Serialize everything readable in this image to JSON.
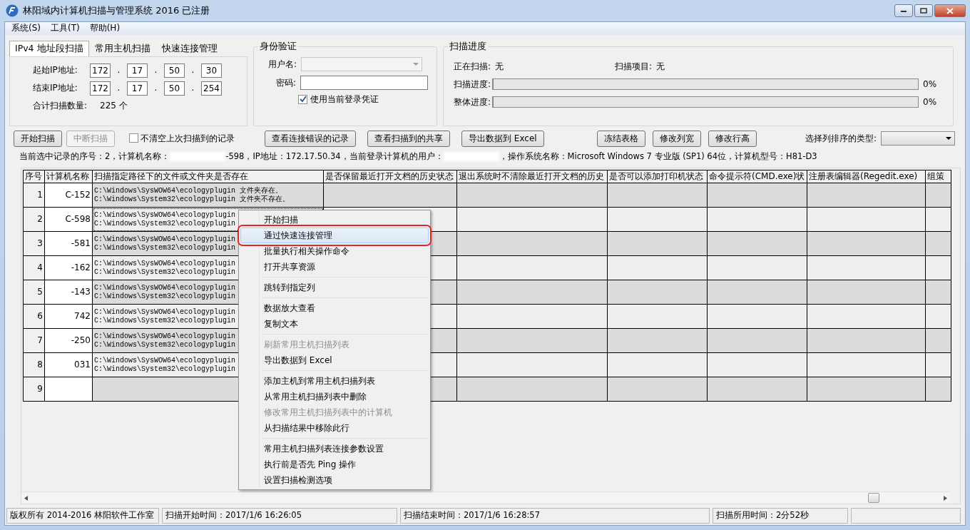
{
  "window": {
    "title": "林阳域内计算机扫描与管理系统 2016 已注册"
  },
  "menu": [
    "系统(S)",
    "工具(T)",
    "帮助(H)"
  ],
  "tabs": [
    {
      "label": "IPv4 地址段扫描",
      "selected": true
    },
    {
      "label": "常用主机扫描",
      "selected": false
    },
    {
      "label": "快速连接管理",
      "selected": false
    }
  ],
  "ip_range": {
    "rows": [
      {
        "label": "起始IP地址:",
        "parts": [
          {
            "kind": "field",
            "value": "172"
          },
          {
            "kind": "dot",
            "text": "."
          },
          {
            "kind": "field",
            "value": "17"
          },
          {
            "kind": "dot",
            "text": "."
          },
          {
            "kind": "field",
            "value": "50"
          },
          {
            "kind": "dot",
            "text": "."
          },
          {
            "kind": "field",
            "value": "30"
          }
        ]
      },
      {
        "label": "结束IP地址:",
        "parts": [
          {
            "kind": "field",
            "value": "172"
          },
          {
            "kind": "dot",
            "text": "."
          },
          {
            "kind": "field",
            "value": "17"
          },
          {
            "kind": "dot",
            "text": "."
          },
          {
            "kind": "field",
            "value": "50"
          },
          {
            "kind": "dot",
            "text": "."
          },
          {
            "kind": "field",
            "value": "254"
          }
        ]
      }
    ],
    "count_label": "合计扫描数量:",
    "count_value": "225 个"
  },
  "auth": {
    "title": "身份验证",
    "username_label": "用户名:",
    "username_disabled": true,
    "password_label": "密码:",
    "use_current": {
      "label": "使用当前登录凭证",
      "checked": true
    }
  },
  "progress": {
    "title": "扫描进度",
    "scanning_label": "正在扫描:",
    "scanning_value": "无",
    "item_label": "扫描项目:",
    "item_value": "无",
    "bars": [
      {
        "label": "扫描进度:",
        "level": 0,
        "reading": "0%"
      },
      {
        "label": "整体进度:",
        "level": 0,
        "reading": "0%"
      }
    ]
  },
  "toolbar": {
    "items": [
      {
        "kind": "button",
        "label": "开始扫描",
        "disabled": false
      },
      {
        "kind": "button",
        "label": "中断扫描",
        "disabled": true
      },
      {
        "kind": "checkbox",
        "label": "不清空上次扫描到的记录",
        "checked": false
      },
      {
        "kind": "button",
        "label": "查看连接错误的记录",
        "disabled": false
      },
      {
        "kind": "button",
        "label": "查看扫描到的共享",
        "disabled": false
      },
      {
        "kind": "button",
        "label": "导出数据到 Excel",
        "disabled": false
      }
    ],
    "table_buttons": [
      "冻结表格",
      "修改列宽",
      "修改行高"
    ],
    "sort_label": "选择列排序的类型:"
  },
  "selection_info": [
    {
      "kind": "text",
      "text": "当前选中记录的序号：2，计算机名称："
    },
    {
      "kind": "redacted"
    },
    {
      "kind": "text",
      "text": "-598，IP地址：172.17.50.34，当前登录计算机的用户："
    },
    {
      "kind": "redacted"
    },
    {
      "kind": "text",
      "text": "，操作系统名称：Microsoft Windows 7 专业版 (SP1) 64位，计算机型号：H81-D3"
    }
  ],
  "table": {
    "columns": [
      "序号",
      "计算机名称",
      "扫描指定路径下的文件或文件夹是否存在",
      "是否保留最近打开文档的历史状态",
      "退出系统时不清除最近打开文档的历史",
      "是否可以添加打印机状态",
      "命令提示符(CMD.exe)状",
      "注册表编辑器(Regedit.exe)",
      "组策"
    ],
    "rows": [
      {
        "index": "1",
        "name": "C-152",
        "path_lines": [
          "C:\\Windows\\SysWOW64\\ecologyplugin 文件夹存在。",
          "C:\\Windows\\System32\\ecologyplugin 文件夹不存在。"
        ],
        "selected": false
      },
      {
        "index": "2",
        "name": "C-598",
        "path_lines": [
          "C:\\Windows\\SysWOW64\\ecologyplugin",
          "C:\\Windows\\System32\\ecologyplugin"
        ],
        "selected": true
      },
      {
        "index": "3",
        "name": "-581",
        "path_lines": [
          "C:\\Windows\\SysWOW64\\ecologyplugin",
          "C:\\Windows\\System32\\ecologyplugin"
        ],
        "selected": false
      },
      {
        "index": "4",
        "name": "-162",
        "path_lines": [
          "C:\\Windows\\SysWOW64\\ecologyplugin",
          "C:\\Windows\\System32\\ecologyplugin"
        ],
        "selected": false
      },
      {
        "index": "5",
        "name": "-143",
        "path_lines": [
          "C:\\Windows\\SysWOW64\\ecologyplugin",
          "C:\\Windows\\System32\\ecologyplugin"
        ],
        "selected": false
      },
      {
        "index": "6",
        "name": "742",
        "path_lines": [
          "C:\\Windows\\SysWOW64\\ecologyplugin",
          "C:\\Windows\\System32\\ecologyplugin"
        ],
        "selected": false
      },
      {
        "index": "7",
        "name": "-250",
        "path_lines": [
          "C:\\Windows\\SysWOW64\\ecologyplugin",
          "C:\\Windows\\System32\\ecologyplugin"
        ],
        "selected": false
      },
      {
        "index": "8",
        "name": "031",
        "path_lines": [
          "C:\\Windows\\SysWOW64\\ecologyplugin",
          "C:\\Windows\\System32\\ecologyplugin"
        ],
        "selected": false
      },
      {
        "index": "9",
        "selected": false
      }
    ]
  },
  "context_menu": {
    "groups": [
      [
        {
          "label": "开始扫描",
          "disabled": false,
          "selected": false
        },
        {
          "label": "通过快速连接管理",
          "disabled": false,
          "selected": true
        },
        {
          "label": "批量执行相关操作命令",
          "disabled": false,
          "selected": false
        },
        {
          "label": "打开共享资源",
          "disabled": false,
          "selected": false
        }
      ],
      [
        {
          "label": "跳转到指定列",
          "disabled": false,
          "selected": false
        }
      ],
      [
        {
          "label": "数据放大查看",
          "disabled": false,
          "selected": false
        },
        {
          "label": "复制文本",
          "disabled": false,
          "selected": false
        }
      ],
      [
        {
          "label": "刷新常用主机扫描列表",
          "disabled": true,
          "selected": false
        },
        {
          "label": "导出数据到 Excel",
          "disabled": false,
          "selected": false
        }
      ],
      [
        {
          "label": "添加主机到常用主机扫描列表",
          "disabled": false,
          "selected": false
        },
        {
          "label": "从常用主机扫描列表中删除",
          "disabled": false,
          "selected": false
        },
        {
          "label": "修改常用主机扫描列表中的计算机",
          "disabled": true,
          "selected": false
        },
        {
          "label": "从扫描结果中移除此行",
          "disabled": false,
          "selected": false
        }
      ],
      [
        {
          "label": "常用主机扫描列表连接参数设置",
          "disabled": false,
          "selected": false
        },
        {
          "label": "执行前是否先 Ping 操作",
          "disabled": false,
          "selected": false
        },
        {
          "label": "设置扫描检测选项",
          "disabled": false,
          "selected": false
        }
      ]
    ]
  },
  "status_bar": [
    "版权所有 2014-2016 林阳软件工作室",
    "扫描开始时间：2017/1/6 16:26:05",
    "扫描结束时间：2017/1/6 16:28:57",
    "扫描所用时间：2分52秒"
  ]
}
